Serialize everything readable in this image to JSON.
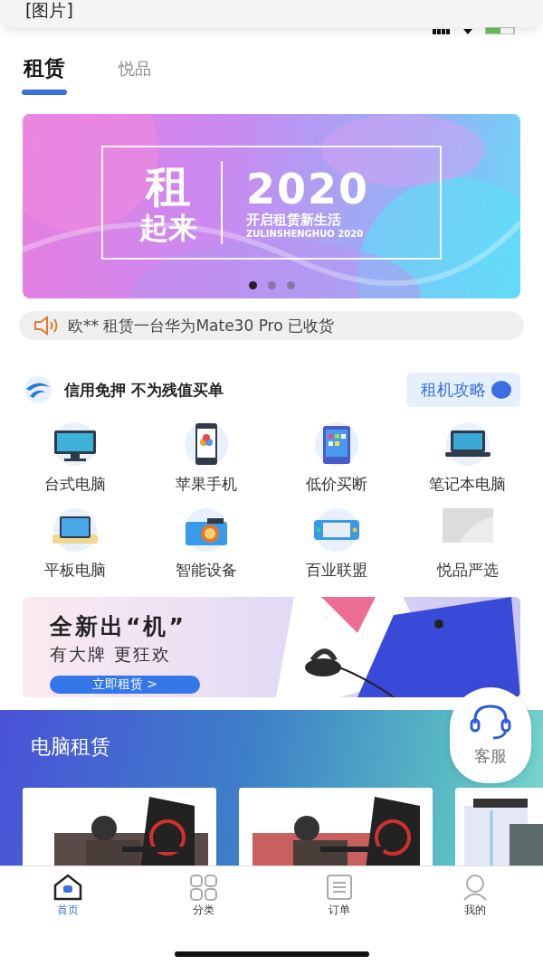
{
  "overlay_bar": {
    "label": "[图片]"
  },
  "tabs": [
    {
      "label": "租赁",
      "selected": true
    },
    {
      "label": "悦品",
      "selected": false
    }
  ],
  "hero_banner": {
    "big_char": "租",
    "big_line": "起来",
    "year": "2020",
    "slogan": "开启租赁新生活",
    "subtitle": "ZULINSHENGHUO 2020",
    "dots": [
      {
        "selected": true
      },
      {
        "selected": false
      },
      {
        "selected": false
      }
    ]
  },
  "notice": {
    "text": "欧** 租赁一台华为Mate30 Pro 已收货"
  },
  "credit": {
    "title": "信用免押 不为残值买单",
    "guide_button": "租机攻略"
  },
  "categories": [
    {
      "label": "台式电脑",
      "kind": "desktop"
    },
    {
      "label": "苹果手机",
      "kind": "phone"
    },
    {
      "label": "低价买断",
      "kind": "tablet"
    },
    {
      "label": "笔记本电脑",
      "kind": "laptop"
    },
    {
      "label": "平板电脑",
      "kind": "screen"
    },
    {
      "label": "智能设备",
      "kind": "camera"
    },
    {
      "label": "百业联盟",
      "kind": "console"
    },
    {
      "label": "悦品严选",
      "kind": "blank"
    }
  ],
  "promo": {
    "headline": "全新出“机”",
    "tagline": "有大牌 更狂欢",
    "button": "立即租赁 >"
  },
  "service_button": {
    "label": "客服"
  },
  "section": {
    "title": "电脑租赁"
  },
  "bottom_nav": [
    {
      "label": "首页",
      "kind": "home",
      "selected": true
    },
    {
      "label": "分类",
      "kind": "grid",
      "selected": false
    },
    {
      "label": "订单",
      "kind": "list",
      "selected": false
    },
    {
      "label": "我的",
      "kind": "user",
      "selected": false
    }
  ]
}
